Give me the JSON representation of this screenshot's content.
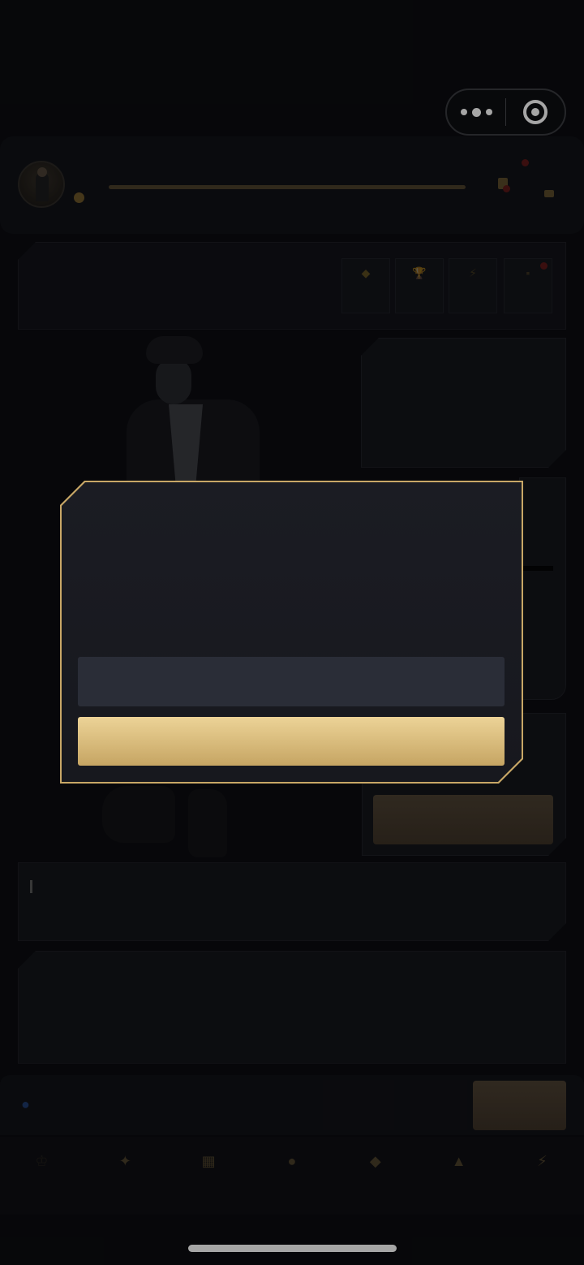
{
  "status_bar": {
    "capsule": {
      "more_icon": "more-dots-icon",
      "close_icon": "target-close-icon"
    }
  },
  "header": {
    "avatar_icon": "player-avatar",
    "coin_icon": "coin-icon",
    "right_icons": [
      "book-icon",
      "gift-icon"
    ]
  },
  "stats": {
    "items": [
      {
        "icon": "diamond-icon",
        "glyph": "◆"
      },
      {
        "icon": "trophy-icon",
        "glyph": "🏆"
      },
      {
        "icon": "lightning-icon",
        "glyph": "⚡"
      },
      {
        "icon": "bag-icon",
        "glyph": "▪"
      }
    ]
  },
  "bottom_bar": {
    "flame_icon": "flame-icon"
  },
  "tabs": [
    {
      "icon": "rank-icon",
      "glyph": "♔"
    },
    {
      "icon": "dash-icon",
      "glyph": "✦"
    },
    {
      "icon": "city-icon",
      "glyph": "▦"
    },
    {
      "icon": "friends-icon",
      "glyph": "●"
    },
    {
      "icon": "diamond-icon",
      "glyph": "◆"
    },
    {
      "icon": "rank-podium-icon",
      "glyph": "▲"
    },
    {
      "icon": "lightning-icon",
      "glyph": "⚡"
    }
  ],
  "modal": {
    "cancel_label": "",
    "confirm_label": ""
  },
  "colors": {
    "accent_gold": "#c8a766",
    "background": "#0b0c10",
    "modal_bg": "#1b1c23",
    "cancel_bg": "#2a2d37"
  }
}
